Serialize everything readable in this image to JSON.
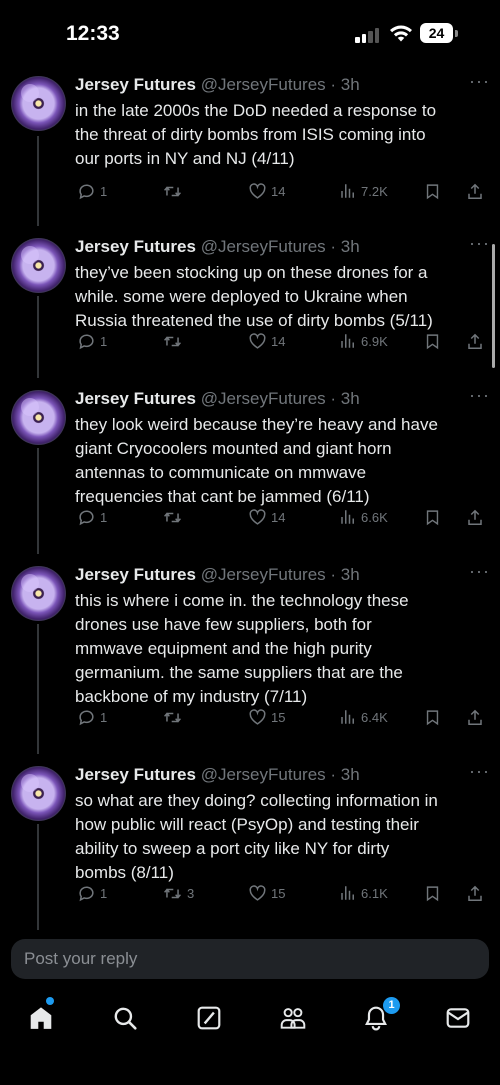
{
  "status_bar": {
    "time": "12:33",
    "battery": "24"
  },
  "tweets": [
    {
      "name": "Jersey Futures",
      "handle_time": "@JerseyFutures · 3h",
      "text": "in the late 2000s the DoD needed a response to\nthe threat of dirty bombs from ISIS coming into\nour ports in NY and NJ (4/11)",
      "replies": "1",
      "retweets": "",
      "likes": "14",
      "views": "7.2K"
    },
    {
      "name": "Jersey Futures",
      "handle_time": "@JerseyFutures · 3h",
      "text": "they’ve been stocking up on these drones for a\nwhile. some were deployed to Ukraine when\nRussia threatened the use of dirty bombs (5/11)",
      "replies": "1",
      "retweets": "",
      "likes": "14",
      "views": "6.9K"
    },
    {
      "name": "Jersey Futures",
      "handle_time": "@JerseyFutures · 3h",
      "text": "they look weird because they’re heavy and have\ngiant Cryocoolers mounted and giant horn\nantennas to communicate on mmwave\nfrequencies that cant be jammed (6/11)",
      "replies": "1",
      "retweets": "",
      "likes": "14",
      "views": "6.6K"
    },
    {
      "name": "Jersey Futures",
      "handle_time": "@JerseyFutures · 3h",
      "text": "this is where i come in. the technology these\ndrones use have few suppliers, both for\nmmwave equipment and the high purity\ngermanium. the same suppliers that are the\nbackbone of my industry (7/11)",
      "replies": "1",
      "retweets": "",
      "likes": "15",
      "views": "6.4K"
    },
    {
      "name": "Jersey Futures",
      "handle_time": "@JerseyFutures · 3h",
      "text": "so what are they doing? collecting information in\nhow public will react (PsyOp) and testing their\nability to sweep a port city like NY for dirty\nbombs (8/11)",
      "replies": "1",
      "retweets": "3",
      "likes": "15",
      "views": "6.1K"
    }
  ],
  "reply": {
    "placeholder": "Post your reply"
  },
  "tabbar": {
    "items": [
      "home-icon",
      "search-icon",
      "grok-icon",
      "communities-icon",
      "notifications-icon",
      "messages-icon"
    ],
    "notification_count": "1"
  },
  "colors": {
    "background": "#000000",
    "text": "#e7e9ea",
    "muted": "#71767b",
    "accent": "#1d9bf0"
  }
}
